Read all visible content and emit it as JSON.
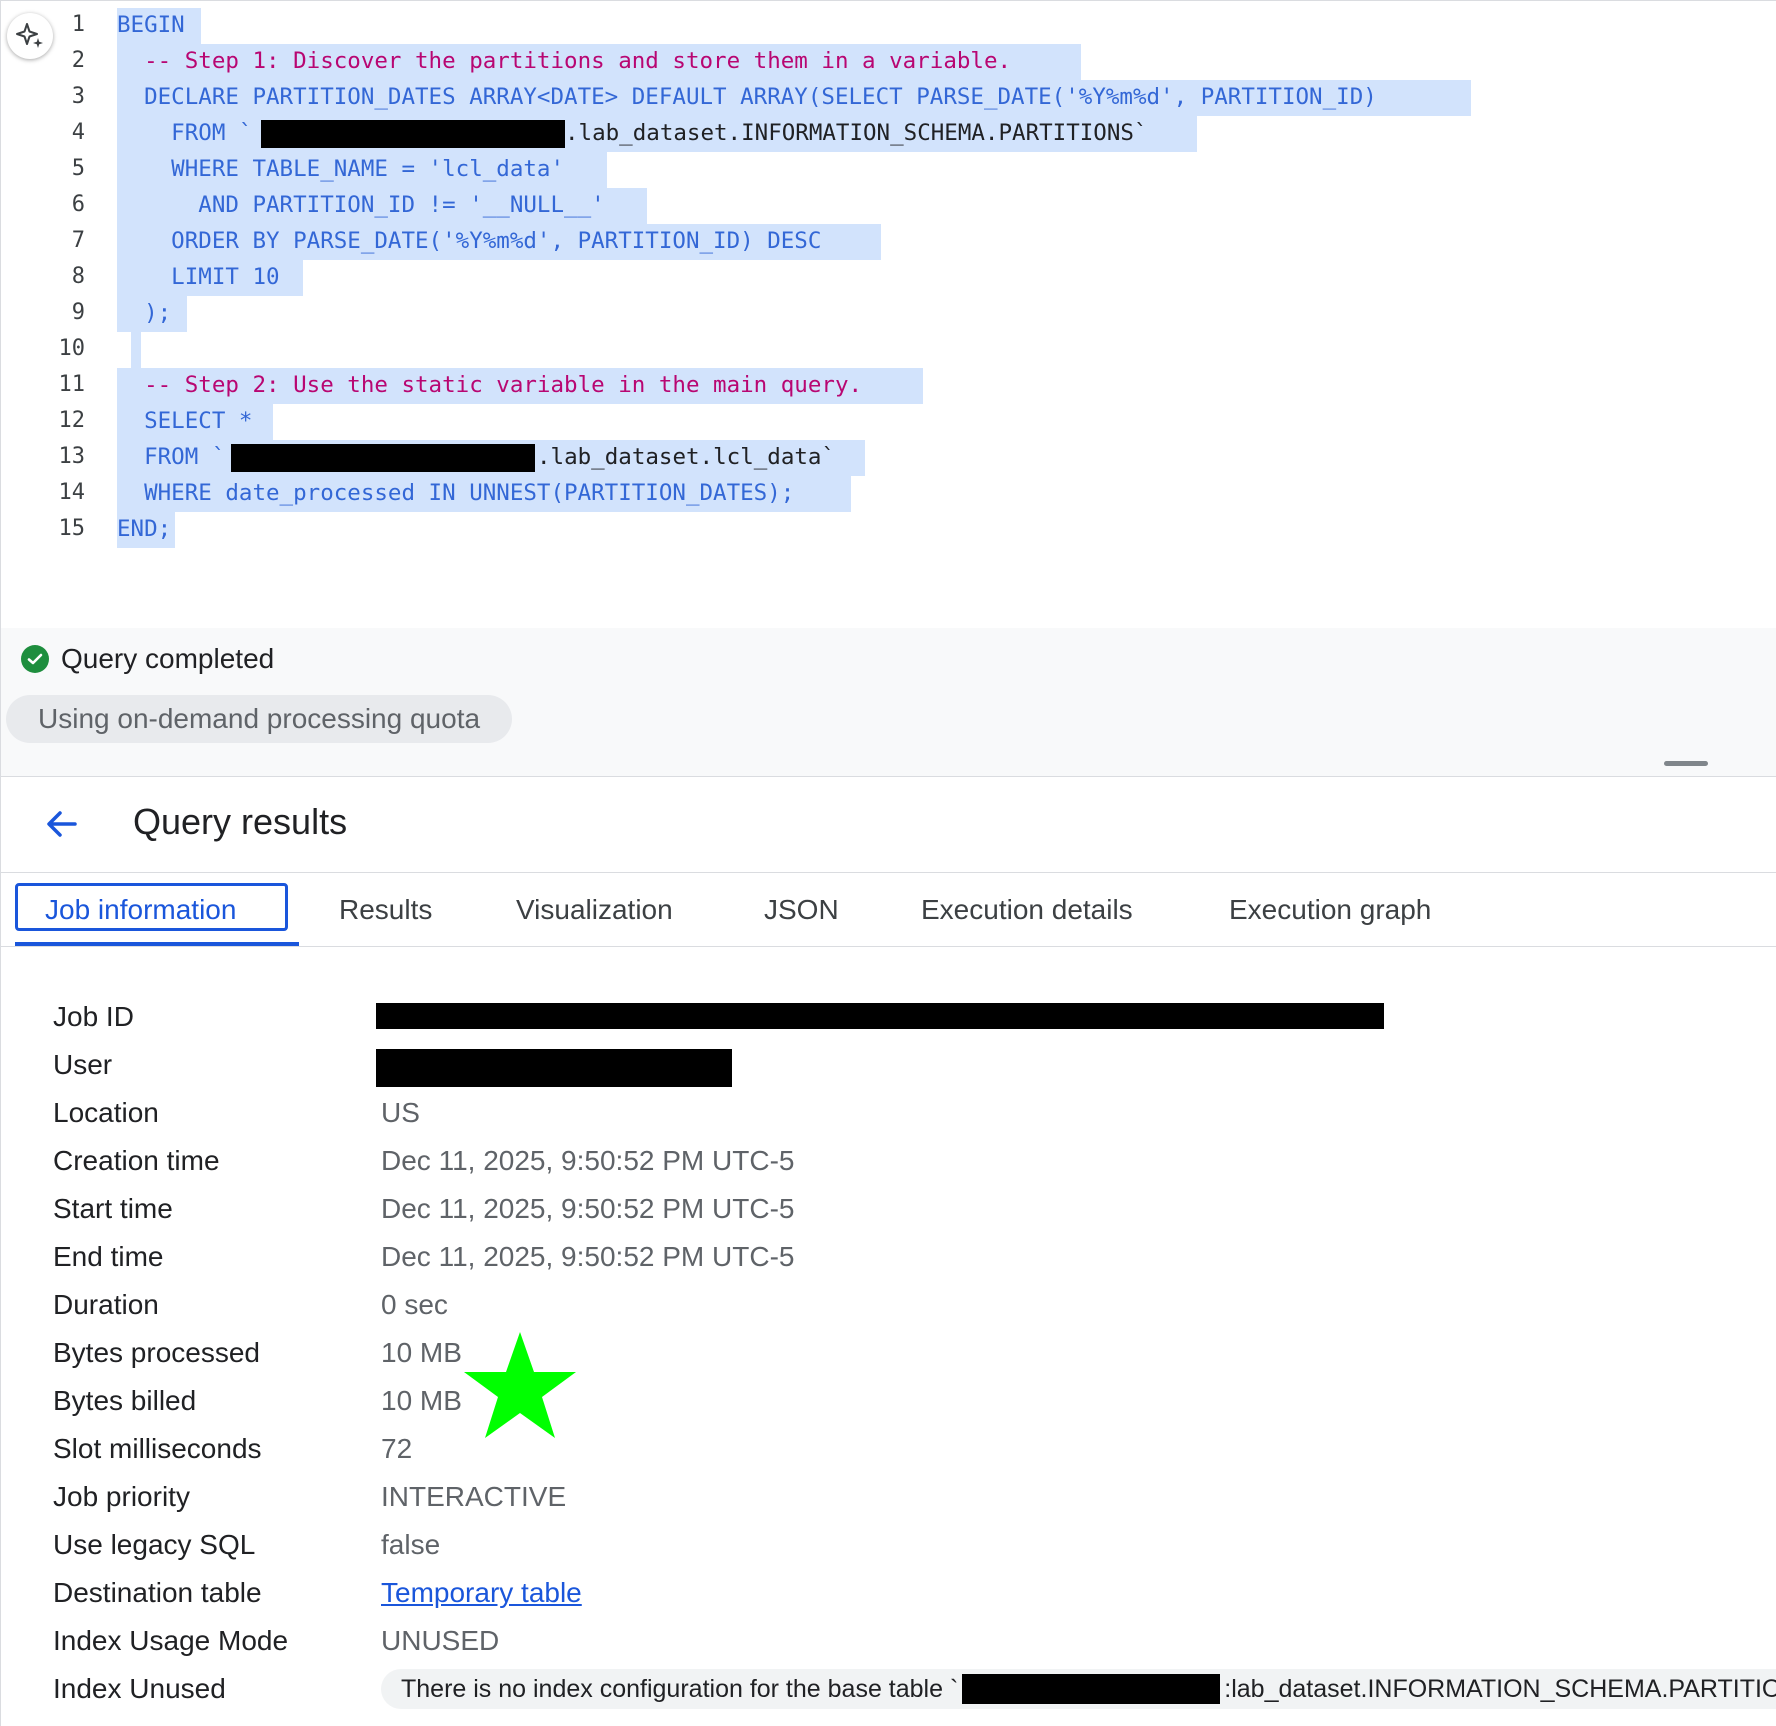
{
  "editor": {
    "lines": [
      {
        "n": "1",
        "text": "BEGIN"
      },
      {
        "n": "2",
        "text": "  -- Step 1: Discover the partitions and store them in a variable."
      },
      {
        "n": "3",
        "text": "  DECLARE PARTITION_DATES ARRAY<DATE> DEFAULT ARRAY(SELECT PARSE_DATE('%Y%m%d', PARTITION_ID)"
      },
      {
        "n": "4a",
        "text": "    FROM `"
      },
      {
        "n": "4b",
        "text": ".lab_dataset.INFORMATION_SCHEMA.PARTITIONS`"
      },
      {
        "n": "5",
        "text": "    WHERE TABLE_NAME = 'lcl_data'"
      },
      {
        "n": "6",
        "text": "      AND PARTITION_ID != '__NULL__'"
      },
      {
        "n": "7",
        "text": "    ORDER BY PARSE_DATE('%Y%m%d', PARTITION_ID) DESC"
      },
      {
        "n": "8",
        "text": "    LIMIT 10"
      },
      {
        "n": "9",
        "text": "  );"
      },
      {
        "n": "10",
        "text": ""
      },
      {
        "n": "11",
        "text": "  -- Step 2: Use the static variable in the main query."
      },
      {
        "n": "12",
        "text": "  SELECT *"
      },
      {
        "n": "13a",
        "text": "  FROM `"
      },
      {
        "n": "13b",
        "text": ".lab_dataset.lcl_data`"
      },
      {
        "n": "14",
        "text": "  WHERE date_processed IN UNNEST(PARTITION_DATES);"
      },
      {
        "n": "15",
        "text": "END;"
      }
    ]
  },
  "status": {
    "message": "Query completed",
    "quota": "Using on-demand processing quota"
  },
  "results": {
    "title": "Query results",
    "tabs": [
      "Job information",
      "Results",
      "Visualization",
      "JSON",
      "Execution details",
      "Execution graph"
    ],
    "rows": [
      {
        "label": "Job ID",
        "value": ""
      },
      {
        "label": "User",
        "value": ""
      },
      {
        "label": "Location",
        "value": "US"
      },
      {
        "label": "Creation time",
        "value": "Dec 11, 2025, 9:50:52 PM UTC-5"
      },
      {
        "label": "Start time",
        "value": "Dec 11, 2025, 9:50:52 PM UTC-5"
      },
      {
        "label": "End time",
        "value": "Dec 11, 2025, 9:50:52 PM UTC-5"
      },
      {
        "label": "Duration",
        "value": "0 sec"
      },
      {
        "label": "Bytes processed",
        "value": "10 MB"
      },
      {
        "label": "Bytes billed",
        "value": "10 MB"
      },
      {
        "label": "Slot milliseconds",
        "value": "72"
      },
      {
        "label": "Job priority",
        "value": "INTERACTIVE"
      },
      {
        "label": "Use legacy SQL",
        "value": "false"
      },
      {
        "label": "Destination table",
        "value": "Temporary table"
      },
      {
        "label": "Index Usage Mode",
        "value": "UNUSED"
      },
      {
        "label": "Index Unused",
        "value": "There is no index configuration for the base table `",
        "value_suffix": ":lab_dataset.INFORMATION_SCHEMA.PARTITIONS`."
      }
    ]
  },
  "colors": {
    "keyword": "#3367d6",
    "comment": "#b80672",
    "string": "#188038",
    "number": "#a35200",
    "selection": "#d2e3fc",
    "star": "#00ff00",
    "accent": "#1a56db"
  },
  "icons": [
    "sparkle-icon",
    "check-circle-icon",
    "back-arrow-icon",
    "star-icon"
  ]
}
